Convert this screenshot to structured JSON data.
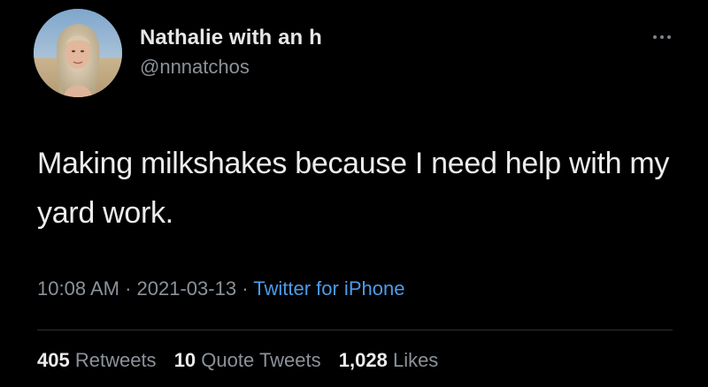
{
  "user": {
    "display_name": "Nathalie with an h",
    "handle": "@nnnatchos"
  },
  "tweet": {
    "text": "Making milkshakes because I need help with my yard work.",
    "time": "10:08 AM",
    "separator": "·",
    "date": "2021-03-13",
    "source": "Twitter for iPhone"
  },
  "stats": {
    "retweets_count": "405",
    "retweets_label": "Retweets",
    "quotes_count": "10",
    "quotes_label": "Quote Tweets",
    "likes_count": "1,028",
    "likes_label": "Likes"
  },
  "colors": {
    "background": "#000000",
    "text": "#ececec",
    "secondary": "#8b9299",
    "link": "#4d9be8"
  },
  "icons": {
    "more": "more-horizontal-icon"
  }
}
